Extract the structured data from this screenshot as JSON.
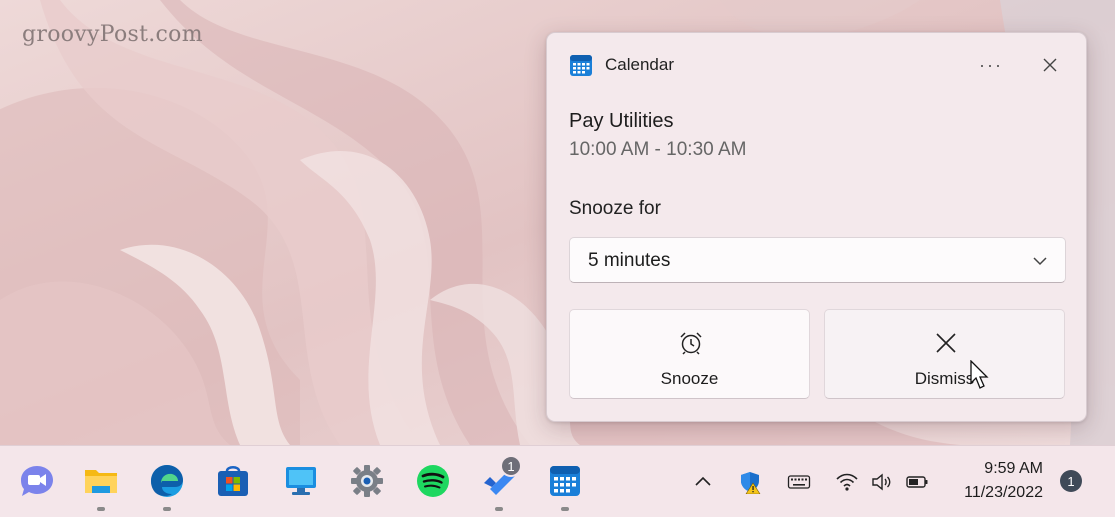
{
  "watermark": "groovyPost.com",
  "toast": {
    "app_name": "Calendar",
    "more_label": "···",
    "event_title": "Pay Utilities",
    "event_time": "10:00 AM - 10:30 AM",
    "snooze_label": "Snooze for",
    "snooze_selected": "5 minutes",
    "snooze_button": "Snooze",
    "dismiss_button": "Dismiss"
  },
  "taskbar": {
    "apps": [
      {
        "name": "Teams Chat",
        "icon": "teams-chat-icon"
      },
      {
        "name": "File Explorer",
        "icon": "folder-icon"
      },
      {
        "name": "Microsoft Edge",
        "icon": "edge-icon"
      },
      {
        "name": "Microsoft Store",
        "icon": "store-icon"
      },
      {
        "name": "Remote Desktop",
        "icon": "monitor-icon"
      },
      {
        "name": "Settings",
        "icon": "gear-icon"
      },
      {
        "name": "Spotify",
        "icon": "spotify-icon"
      },
      {
        "name": "Microsoft To Do",
        "icon": "todo-icon"
      },
      {
        "name": "Calendar",
        "icon": "calendar-icon"
      }
    ],
    "todo_badge": "1",
    "clock_time": "9:59 AM",
    "clock_date": "11/23/2022",
    "notification_count": "1"
  },
  "colors": {
    "accent": "#0067c0",
    "toast_bg": "#f4e9ec",
    "taskbar_bg": "#f4e6ea",
    "spotify_green": "#1ed760"
  }
}
